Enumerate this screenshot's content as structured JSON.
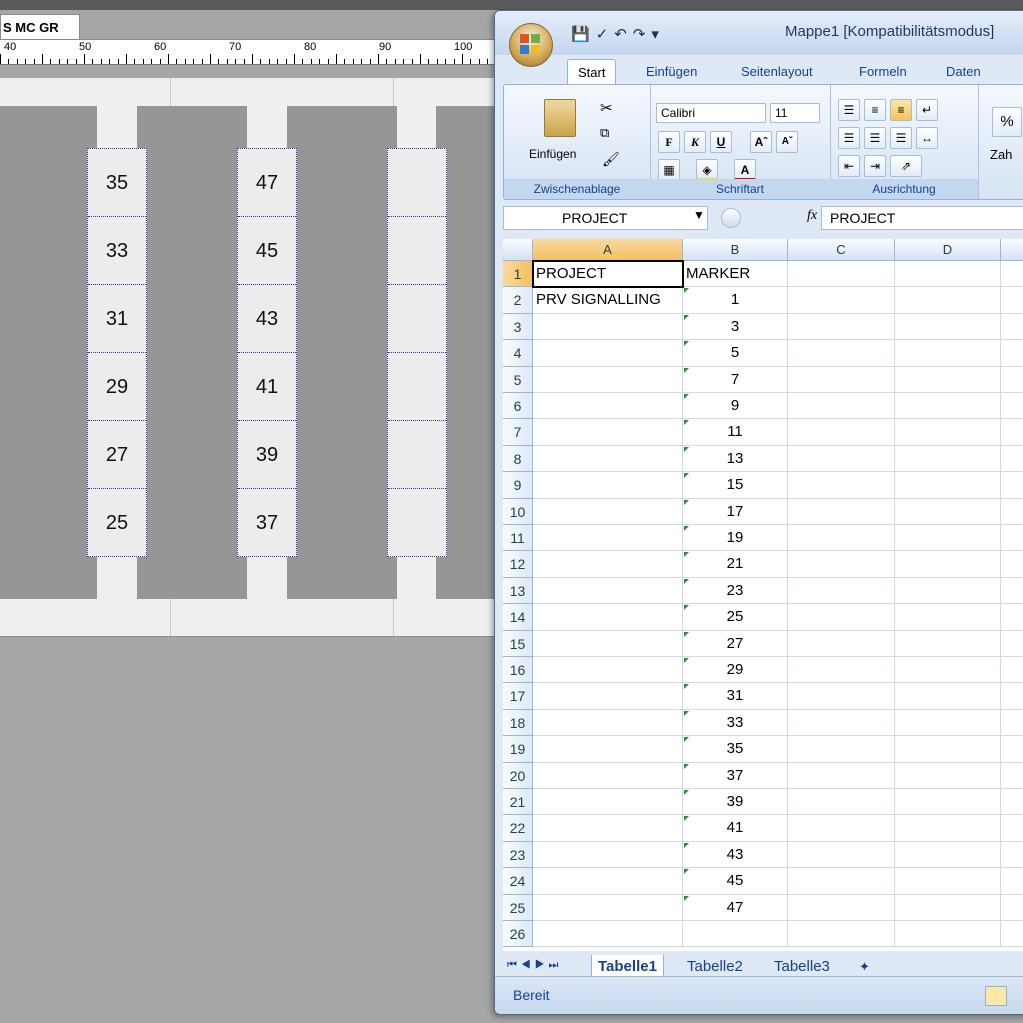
{
  "designer": {
    "tab_label": "S MC GR",
    "ruler_labels": [
      "40",
      "50",
      "60",
      "70",
      "80",
      "90",
      "100"
    ],
    "strips": [
      {
        "values": [
          "35",
          "33",
          "31",
          "29",
          "27",
          "25"
        ]
      },
      {
        "values": [
          "47",
          "45",
          "43",
          "41",
          "39",
          "37"
        ]
      },
      {
        "values": [
          "",
          "",
          "",
          "",
          "",
          ""
        ]
      }
    ]
  },
  "excel": {
    "title": "Mappe1  [Kompatibilitätsmodus]",
    "ribbon_tabs": [
      "Start",
      "Einfügen",
      "Seitenlayout",
      "Formeln",
      "Daten"
    ],
    "active_tab": "Start",
    "groups": {
      "clipboard": {
        "label": "Zwischenablage",
        "paste_label": "Einfügen"
      },
      "font": {
        "label": "Schriftart",
        "font_name": "Calibri",
        "font_size": "11",
        "bold": "F",
        "italic": "K",
        "underline": "U"
      },
      "alignment": {
        "label": "Ausrichtung"
      },
      "number": {
        "label": "Zah",
        "percent": "%"
      }
    },
    "name_box": "PROJECT",
    "fx_label": "fx",
    "formula_value": "PROJECT",
    "columns": [
      "A",
      "B",
      "C",
      "D"
    ],
    "rows": [
      {
        "n": "1",
        "a": "PROJECT",
        "b": "MARKER"
      },
      {
        "n": "2",
        "a": "PRV SIGNALLING",
        "b": "1"
      },
      {
        "n": "3",
        "a": "",
        "b": "3"
      },
      {
        "n": "4",
        "a": "",
        "b": "5"
      },
      {
        "n": "5",
        "a": "",
        "b": "7"
      },
      {
        "n": "6",
        "a": "",
        "b": "9"
      },
      {
        "n": "7",
        "a": "",
        "b": "11"
      },
      {
        "n": "8",
        "a": "",
        "b": "13"
      },
      {
        "n": "9",
        "a": "",
        "b": "15"
      },
      {
        "n": "10",
        "a": "",
        "b": "17"
      },
      {
        "n": "11",
        "a": "",
        "b": "19"
      },
      {
        "n": "12",
        "a": "",
        "b": "21"
      },
      {
        "n": "13",
        "a": "",
        "b": "23"
      },
      {
        "n": "14",
        "a": "",
        "b": "25"
      },
      {
        "n": "15",
        "a": "",
        "b": "27"
      },
      {
        "n": "16",
        "a": "",
        "b": "29"
      },
      {
        "n": "17",
        "a": "",
        "b": "31"
      },
      {
        "n": "18",
        "a": "",
        "b": "33"
      },
      {
        "n": "19",
        "a": "",
        "b": "35"
      },
      {
        "n": "20",
        "a": "",
        "b": "37"
      },
      {
        "n": "21",
        "a": "",
        "b": "39"
      },
      {
        "n": "22",
        "a": "",
        "b": "41"
      },
      {
        "n": "23",
        "a": "",
        "b": "43"
      },
      {
        "n": "24",
        "a": "",
        "b": "45"
      },
      {
        "n": "25",
        "a": "",
        "b": "47"
      },
      {
        "n": "26",
        "a": "",
        "b": ""
      }
    ],
    "sheet_tabs": [
      "Tabelle1",
      "Tabelle2",
      "Tabelle3"
    ],
    "active_sheet": "Tabelle1",
    "status": "Bereit"
  }
}
